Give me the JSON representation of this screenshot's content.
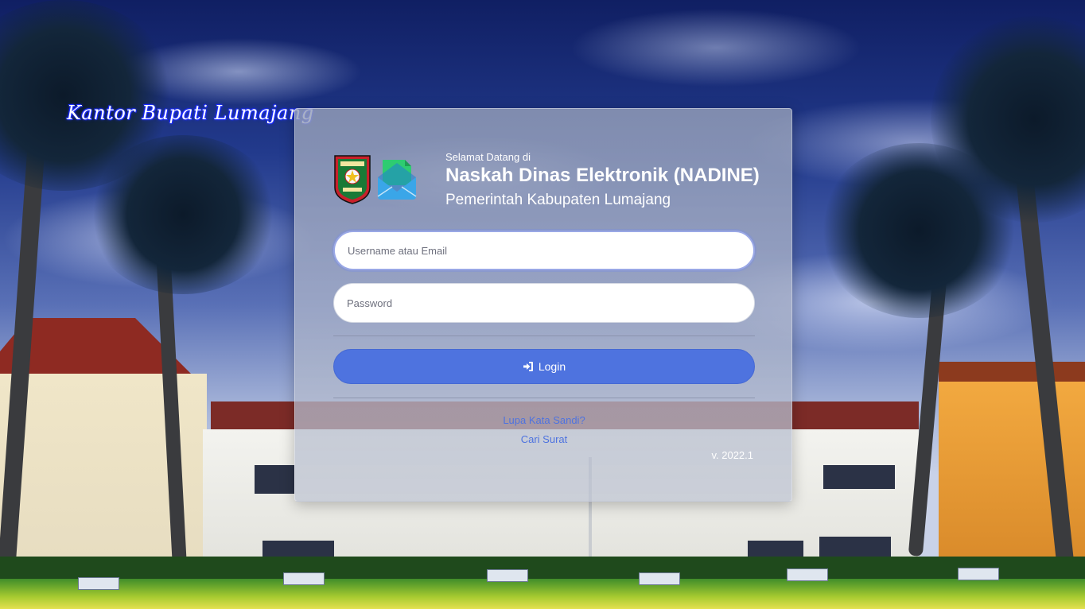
{
  "background": {
    "brand_script": "Kantor Bupati Lumajang"
  },
  "header": {
    "welcome": "Selamat Datang di",
    "title": "Naskah Dinas Elektronik (NADINE)",
    "subtitle": "Pemerintah Kabupaten Lumajang",
    "logos": [
      "emblem-icon",
      "mail-icon"
    ]
  },
  "form": {
    "username_placeholder": "Username atau Email",
    "username_value": "",
    "password_placeholder": "Password",
    "password_value": "",
    "login_label": "Login",
    "login_icon": "sign-in-icon"
  },
  "links": {
    "forgot": "Lupa Kata Sandi?",
    "search_letter": "Cari Surat"
  },
  "footer": {
    "version": "v. 2022.1"
  },
  "colors": {
    "primary": "#4e73df",
    "card_bg": "#a0a8c0",
    "text_light": "#ffffff"
  }
}
